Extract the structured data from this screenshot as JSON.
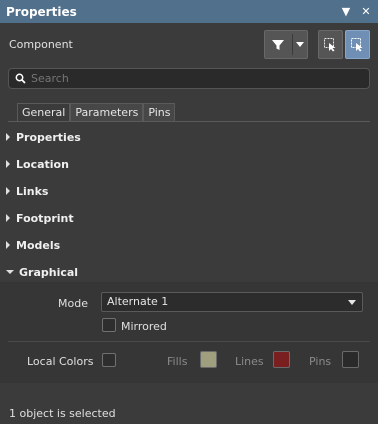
{
  "window": {
    "title": "Properties",
    "menu_icon": "dropdown-arrow-icon",
    "close_icon": "close-icon"
  },
  "component": {
    "label": "Component",
    "filter_icon": "filter-icon"
  },
  "search": {
    "placeholder": "Search"
  },
  "tabs": [
    {
      "label": "General",
      "active": true
    },
    {
      "label": "Parameters",
      "active": false
    },
    {
      "label": "Pins",
      "active": false
    }
  ],
  "sections": [
    {
      "label": "Properties",
      "expanded": false
    },
    {
      "label": "Location",
      "expanded": false
    },
    {
      "label": "Links",
      "expanded": false
    },
    {
      "label": "Footprint",
      "expanded": false
    },
    {
      "label": "Models",
      "expanded": false
    },
    {
      "label": "Graphical",
      "expanded": true
    }
  ],
  "graphical": {
    "mode_label": "Mode",
    "mode_value": "Alternate 1",
    "mirrored_label": "Mirrored",
    "mirrored_checked": false,
    "local_colors_label": "Local Colors",
    "local_colors_checked": false,
    "fills_label": "Fills",
    "lines_label": "Lines",
    "pins_label": "Pins",
    "fills_color": "#9f9f7f",
    "lines_color": "#7a1f1f",
    "pins_color": "#2a2a2a"
  },
  "status": {
    "text": "1 object is selected"
  },
  "colors": {
    "titlebar": "#50708c",
    "active_select_button": "#6f8fb5"
  }
}
